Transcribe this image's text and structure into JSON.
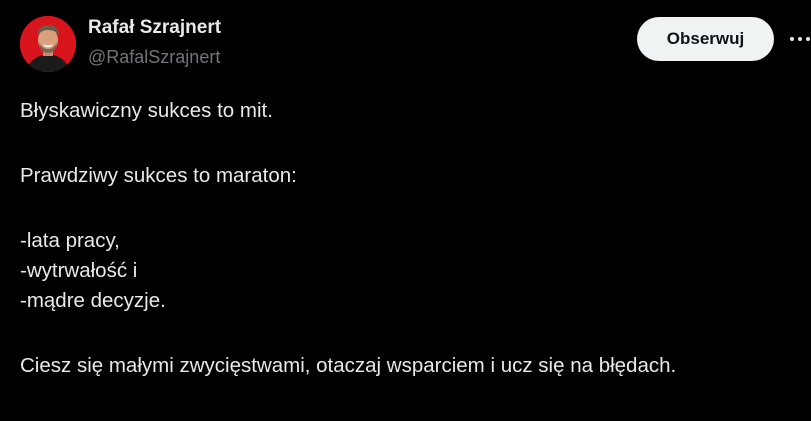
{
  "author": {
    "name": "Rafał Szrajnert",
    "handle": "@RafalSzrajnert"
  },
  "actions": {
    "follow_label": "Obserwuj",
    "more_icon": "more-horizontal-icon"
  },
  "tweet": {
    "lines": [
      "Błyskawiczny sukces to mit.",
      "Prawdziwy sukces to maraton:",
      "-lata pracy,",
      "-wytrwałość i",
      "-mądre decyzje.",
      "Ciesz się małymi zwycięstwami, otaczaj wsparciem i ucz się na błędach."
    ]
  },
  "colors": {
    "background": "#000000",
    "text_primary": "#e7e9ea",
    "text_secondary": "#71767b",
    "button_bg": "#eff3f4",
    "button_text": "#0f1419",
    "avatar_bg": "#d8141c"
  }
}
